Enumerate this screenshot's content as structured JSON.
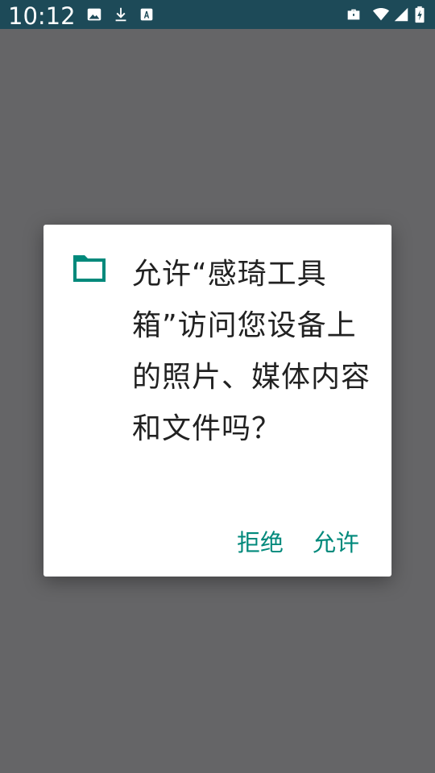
{
  "status_bar": {
    "time": "10:12",
    "icons": [
      "image-icon",
      "download-icon",
      "a-icon",
      "briefcase-icon",
      "wifi-icon",
      "signal-icon",
      "battery-charging-icon"
    ]
  },
  "colors": {
    "status_bar_bg": "#1d4a58",
    "scrim": "#656567",
    "accent": "#00897b",
    "text": "#212121"
  },
  "dialog": {
    "icon": "folder-icon",
    "message": "允许“感琦工具箱”访问您设备上的照片、媒体内容和文件吗？",
    "deny_label": "拒绝",
    "allow_label": "允许"
  }
}
